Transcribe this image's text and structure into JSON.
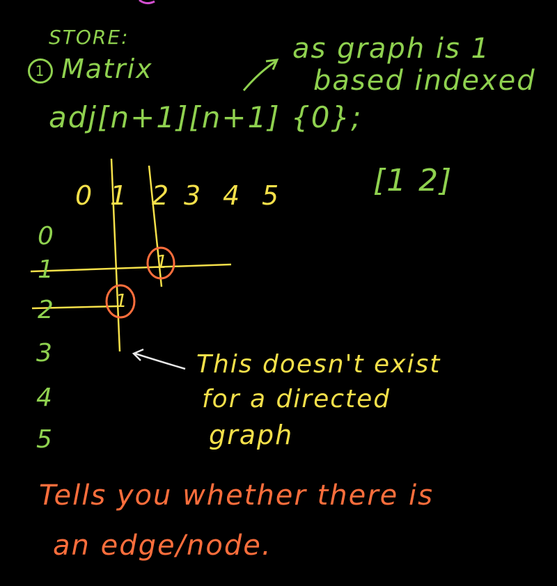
{
  "colors": {
    "background": "#000000",
    "green": "#8fd14f",
    "yellow": "#f5e04a",
    "orange": "#ff6e3c",
    "white": "#e8e8e8"
  },
  "header": {
    "store_label": "STORE:",
    "item_number": "1",
    "item_label": "Matrix"
  },
  "note_top": {
    "line1": "as graph is 1",
    "line2": "based indexed"
  },
  "declaration": "adj[n+1][n+1] {0};",
  "edge_example": "[1 2]",
  "matrix": {
    "column_labels": [
      "0",
      "1",
      "2",
      "3",
      "4",
      "5"
    ],
    "row_labels": [
      "0",
      "1",
      "2",
      "3",
      "4",
      "5"
    ],
    "cell_1_2": "1",
    "cell_2_1": "1"
  },
  "note_directed": {
    "line1": "This doesn't exist",
    "line2": "for a directed",
    "line3": "graph"
  },
  "conclusion": {
    "line1": "Tells you whether there is",
    "line2": "an edge/node."
  }
}
